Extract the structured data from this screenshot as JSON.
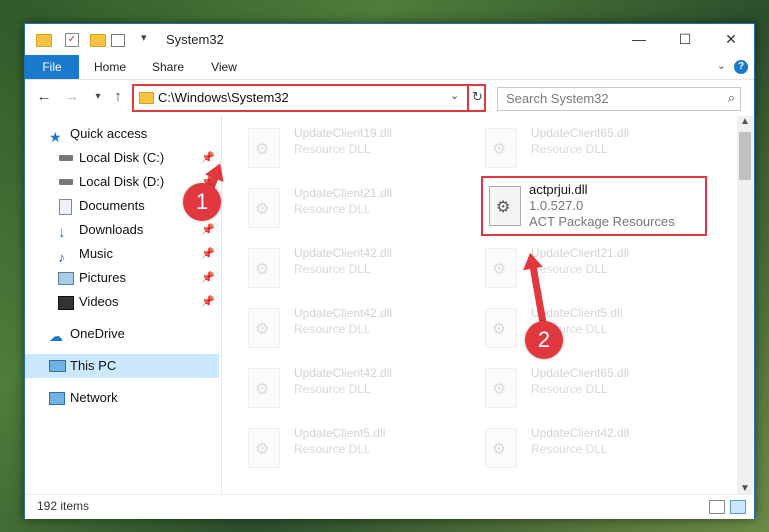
{
  "window": {
    "title": "System32"
  },
  "window_controls": {
    "minimize": "—",
    "maximize": "☐",
    "close": "✕"
  },
  "ribbon": {
    "tabs": [
      "File",
      "Home",
      "Share",
      "View"
    ],
    "help": "?"
  },
  "address": {
    "path": "C:\\Windows\\System32"
  },
  "search": {
    "placeholder": "Search System32"
  },
  "sidebar": {
    "items": [
      {
        "label": "Quick access",
        "icon": "star-icon"
      },
      {
        "label": "Local Disk (C:)",
        "icon": "drive-icon",
        "pinned": true
      },
      {
        "label": "Local Disk (D:)",
        "icon": "drive-icon",
        "pinned": true
      },
      {
        "label": "Documents",
        "icon": "documents-icon",
        "pinned": true
      },
      {
        "label": "Downloads",
        "icon": "download-icon",
        "pinned": true
      },
      {
        "label": "Music",
        "icon": "music-icon",
        "pinned": true
      },
      {
        "label": "Pictures",
        "icon": "pictures-icon",
        "pinned": true
      },
      {
        "label": "Videos",
        "icon": "videos-icon",
        "pinned": true
      },
      {
        "label": "OneDrive",
        "icon": "cloud-icon"
      },
      {
        "label": "This PC",
        "icon": "computer-icon",
        "selected": true
      },
      {
        "label": "Network",
        "icon": "network-icon"
      }
    ]
  },
  "files": [
    {
      "name": "UpdateClient19.dll",
      "desc": "Resource DLL"
    },
    {
      "name": "UpdateClient65.dll",
      "desc": "Resource DLL"
    },
    {
      "name": "UpdateClient21.dll",
      "desc": "Resource DLL"
    },
    {
      "name": "UpdateClient42.dll",
      "desc": "Resource DLL"
    },
    {
      "name": "UpdateClient21.dll",
      "desc": "Resource DLL"
    },
    {
      "name": "UpdateClient42.dll",
      "desc": "Resource DLL"
    },
    {
      "name": "UpdateClient5.dll",
      "desc": "Resource DLL"
    },
    {
      "name": "UpdateClient42.dll",
      "desc": "Resource DLL"
    },
    {
      "name": "UpdateClient65.dll",
      "desc": "Resource DLL"
    },
    {
      "name": "UpdateClient5.dll",
      "desc": "Resource DLL"
    },
    {
      "name": "UpdateClient42.dll",
      "desc": "Resource DLL"
    }
  ],
  "highlighted_file": {
    "name": "actprjui.dll",
    "version": "1.0.527.0",
    "desc": "ACT Package Resources"
  },
  "status": {
    "count": "192 items"
  },
  "annotations": {
    "badge1": "1",
    "badge2": "2"
  },
  "colors": {
    "accent": "#1979ca",
    "highlight": "#e0383e"
  }
}
